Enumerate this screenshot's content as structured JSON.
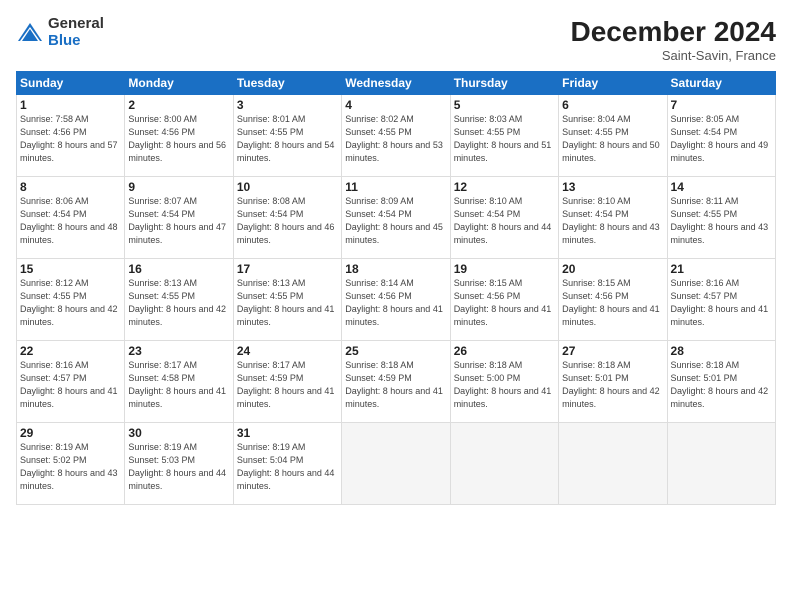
{
  "logo": {
    "general": "General",
    "blue": "Blue"
  },
  "title": "December 2024",
  "location": "Saint-Savin, France",
  "days_of_week": [
    "Sunday",
    "Monday",
    "Tuesday",
    "Wednesday",
    "Thursday",
    "Friday",
    "Saturday"
  ],
  "weeks": [
    [
      {
        "day": 1,
        "rise": "7:58 AM",
        "set": "4:56 PM",
        "daylight": "8 hours and 57 minutes."
      },
      {
        "day": 2,
        "rise": "8:00 AM",
        "set": "4:56 PM",
        "daylight": "8 hours and 56 minutes."
      },
      {
        "day": 3,
        "rise": "8:01 AM",
        "set": "4:55 PM",
        "daylight": "8 hours and 54 minutes."
      },
      {
        "day": 4,
        "rise": "8:02 AM",
        "set": "4:55 PM",
        "daylight": "8 hours and 53 minutes."
      },
      {
        "day": 5,
        "rise": "8:03 AM",
        "set": "4:55 PM",
        "daylight": "8 hours and 51 minutes."
      },
      {
        "day": 6,
        "rise": "8:04 AM",
        "set": "4:55 PM",
        "daylight": "8 hours and 50 minutes."
      },
      {
        "day": 7,
        "rise": "8:05 AM",
        "set": "4:54 PM",
        "daylight": "8 hours and 49 minutes."
      }
    ],
    [
      {
        "day": 8,
        "rise": "8:06 AM",
        "set": "4:54 PM",
        "daylight": "8 hours and 48 minutes."
      },
      {
        "day": 9,
        "rise": "8:07 AM",
        "set": "4:54 PM",
        "daylight": "8 hours and 47 minutes."
      },
      {
        "day": 10,
        "rise": "8:08 AM",
        "set": "4:54 PM",
        "daylight": "8 hours and 46 minutes."
      },
      {
        "day": 11,
        "rise": "8:09 AM",
        "set": "4:54 PM",
        "daylight": "8 hours and 45 minutes."
      },
      {
        "day": 12,
        "rise": "8:10 AM",
        "set": "4:54 PM",
        "daylight": "8 hours and 44 minutes."
      },
      {
        "day": 13,
        "rise": "8:10 AM",
        "set": "4:54 PM",
        "daylight": "8 hours and 43 minutes."
      },
      {
        "day": 14,
        "rise": "8:11 AM",
        "set": "4:55 PM",
        "daylight": "8 hours and 43 minutes."
      }
    ],
    [
      {
        "day": 15,
        "rise": "8:12 AM",
        "set": "4:55 PM",
        "daylight": "8 hours and 42 minutes."
      },
      {
        "day": 16,
        "rise": "8:13 AM",
        "set": "4:55 PM",
        "daylight": "8 hours and 42 minutes."
      },
      {
        "day": 17,
        "rise": "8:13 AM",
        "set": "4:55 PM",
        "daylight": "8 hours and 41 minutes."
      },
      {
        "day": 18,
        "rise": "8:14 AM",
        "set": "4:56 PM",
        "daylight": "8 hours and 41 minutes."
      },
      {
        "day": 19,
        "rise": "8:15 AM",
        "set": "4:56 PM",
        "daylight": "8 hours and 41 minutes."
      },
      {
        "day": 20,
        "rise": "8:15 AM",
        "set": "4:56 PM",
        "daylight": "8 hours and 41 minutes."
      },
      {
        "day": 21,
        "rise": "8:16 AM",
        "set": "4:57 PM",
        "daylight": "8 hours and 41 minutes."
      }
    ],
    [
      {
        "day": 22,
        "rise": "8:16 AM",
        "set": "4:57 PM",
        "daylight": "8 hours and 41 minutes."
      },
      {
        "day": 23,
        "rise": "8:17 AM",
        "set": "4:58 PM",
        "daylight": "8 hours and 41 minutes."
      },
      {
        "day": 24,
        "rise": "8:17 AM",
        "set": "4:59 PM",
        "daylight": "8 hours and 41 minutes."
      },
      {
        "day": 25,
        "rise": "8:18 AM",
        "set": "4:59 PM",
        "daylight": "8 hours and 41 minutes."
      },
      {
        "day": 26,
        "rise": "8:18 AM",
        "set": "5:00 PM",
        "daylight": "8 hours and 41 minutes."
      },
      {
        "day": 27,
        "rise": "8:18 AM",
        "set": "5:01 PM",
        "daylight": "8 hours and 42 minutes."
      },
      {
        "day": 28,
        "rise": "8:18 AM",
        "set": "5:01 PM",
        "daylight": "8 hours and 42 minutes."
      }
    ],
    [
      {
        "day": 29,
        "rise": "8:19 AM",
        "set": "5:02 PM",
        "daylight": "8 hours and 43 minutes."
      },
      {
        "day": 30,
        "rise": "8:19 AM",
        "set": "5:03 PM",
        "daylight": "8 hours and 44 minutes."
      },
      {
        "day": 31,
        "rise": "8:19 AM",
        "set": "5:04 PM",
        "daylight": "8 hours and 44 minutes."
      },
      null,
      null,
      null,
      null
    ]
  ]
}
